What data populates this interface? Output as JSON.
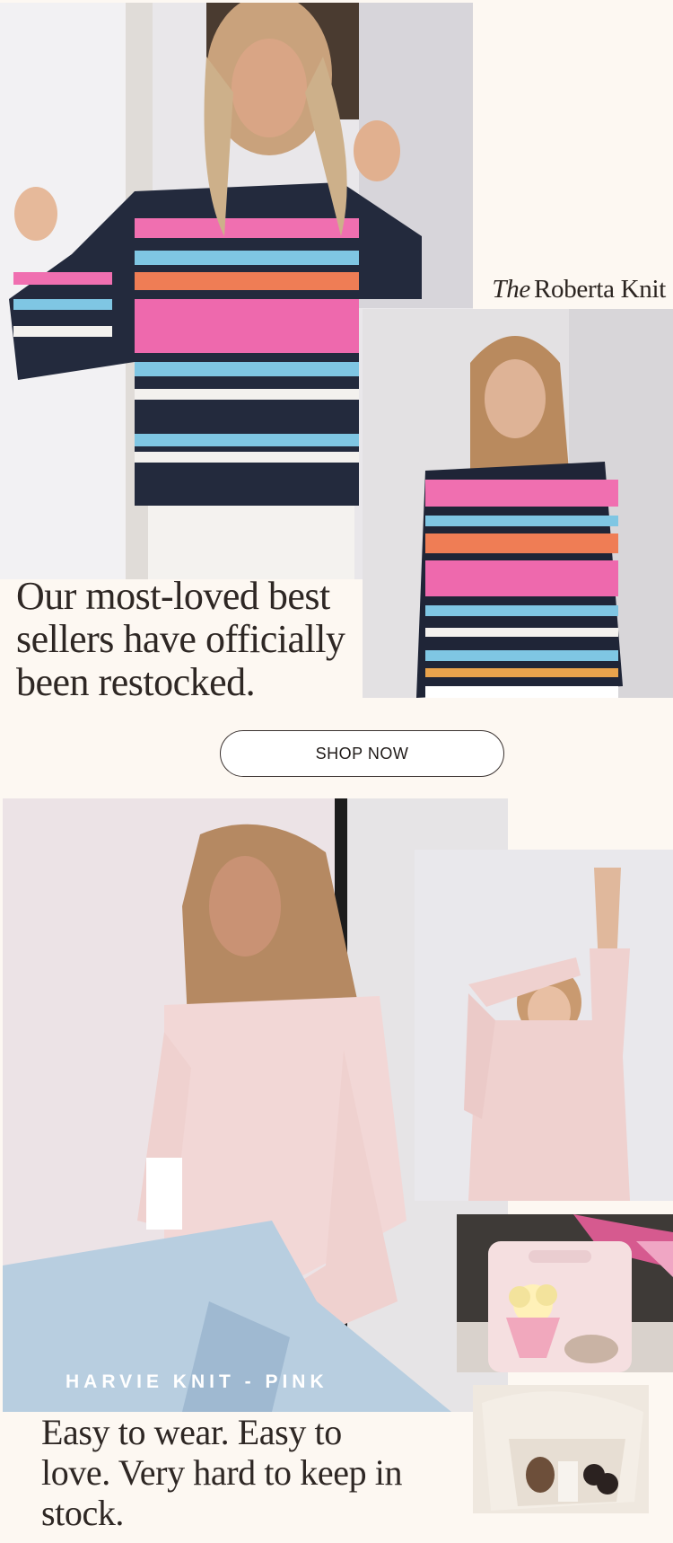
{
  "brand": {
    "prefix": "The",
    "name": "Roberta Knit"
  },
  "hero": {
    "headline": "Our most-loved best sellers have officially been restocked."
  },
  "cta": {
    "label": "SHOP NOW"
  },
  "feature": {
    "product_label": "HARVIE KNIT - PINK",
    "headline": "Easy to wear. Easy to love. Very hard to keep in stock."
  },
  "colors": {
    "background": "#fdf8f2",
    "text": "#2e2724",
    "button_border": "#3a3230"
  }
}
